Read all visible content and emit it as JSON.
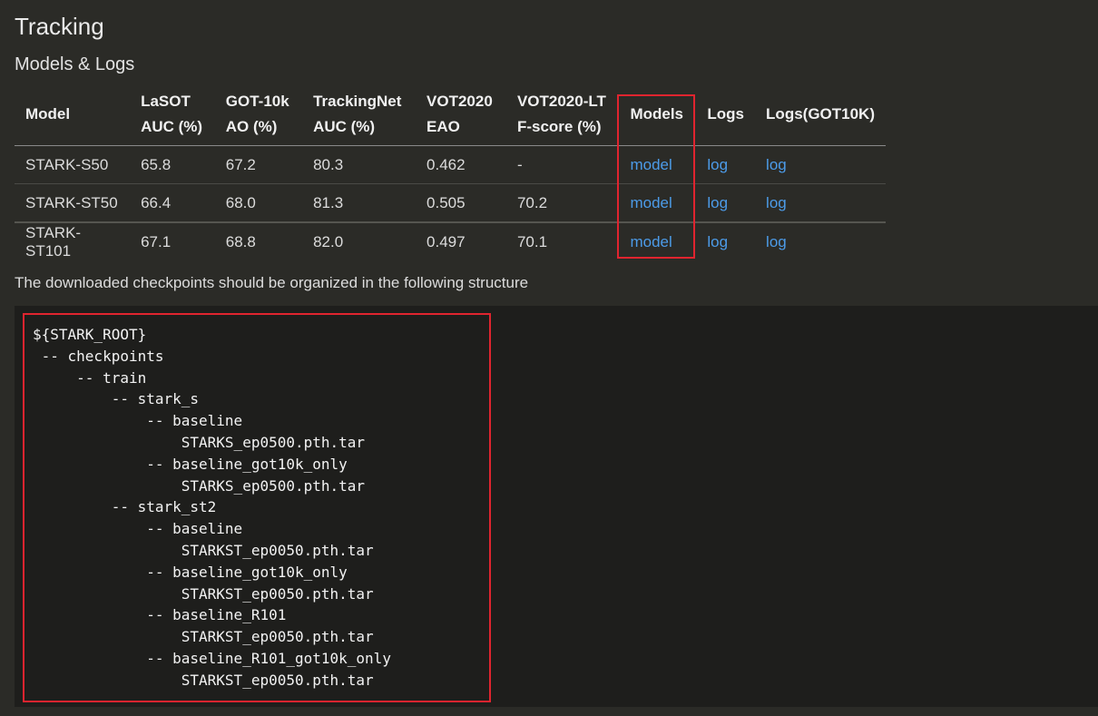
{
  "page": {
    "title": "Tracking",
    "subtitle": "Models & Logs",
    "paragraph": "The downloaded checkpoints should be organized in the following structure"
  },
  "table": {
    "headers": {
      "model": "Model",
      "lasot_1": "LaSOT",
      "lasot_2": "AUC (%)",
      "got_1": "GOT-10k",
      "got_2": "AO (%)",
      "tn_1": "TrackingNet",
      "tn_2": "AUC (%)",
      "vot_1": "VOT2020",
      "vot_2": "EAO",
      "votlt_1": "VOT2020-LT",
      "votlt_2": "F-score (%)",
      "models": "Models",
      "logs": "Logs",
      "logs_got": "Logs(GOT10K)"
    },
    "rows": [
      {
        "model": "STARK-S50",
        "lasot": "65.8",
        "got": "67.2",
        "tn": "80.3",
        "vot": "0.462",
        "votlt": "-",
        "models_link": "model",
        "logs_link": "log",
        "logs_got_link": "log"
      },
      {
        "model": "STARK-ST50",
        "lasot": "66.4",
        "got": "68.0",
        "tn": "81.3",
        "vot": "0.505",
        "votlt": "70.2",
        "models_link": "model",
        "logs_link": "log",
        "logs_got_link": "log"
      },
      {
        "model": "STARK-ST101",
        "lasot": "67.1",
        "got": "68.8",
        "tn": "82.0",
        "vot": "0.497",
        "votlt": "70.1",
        "models_link": "model",
        "logs_link": "log",
        "logs_got_link": "log"
      }
    ]
  },
  "code": {
    "lines": [
      "${STARK_ROOT}",
      " -- checkpoints",
      "     -- train",
      "         -- stark_s",
      "             -- baseline",
      "                 STARKS_ep0500.pth.tar",
      "             -- baseline_got10k_only",
      "                 STARKS_ep0500.pth.tar",
      "         -- stark_st2",
      "             -- baseline",
      "                 STARKST_ep0050.pth.tar",
      "             -- baseline_got10k_only",
      "                 STARKST_ep0050.pth.tar",
      "             -- baseline_R101",
      "                 STARKST_ep0050.pth.tar",
      "             -- baseline_R101_got10k_only",
      "                 STARKST_ep0050.pth.tar"
    ]
  },
  "colors": {
    "background": "#2b2b27",
    "code_background": "#1e1e1c",
    "link": "#4c9be8",
    "highlight": "#e0242f"
  }
}
